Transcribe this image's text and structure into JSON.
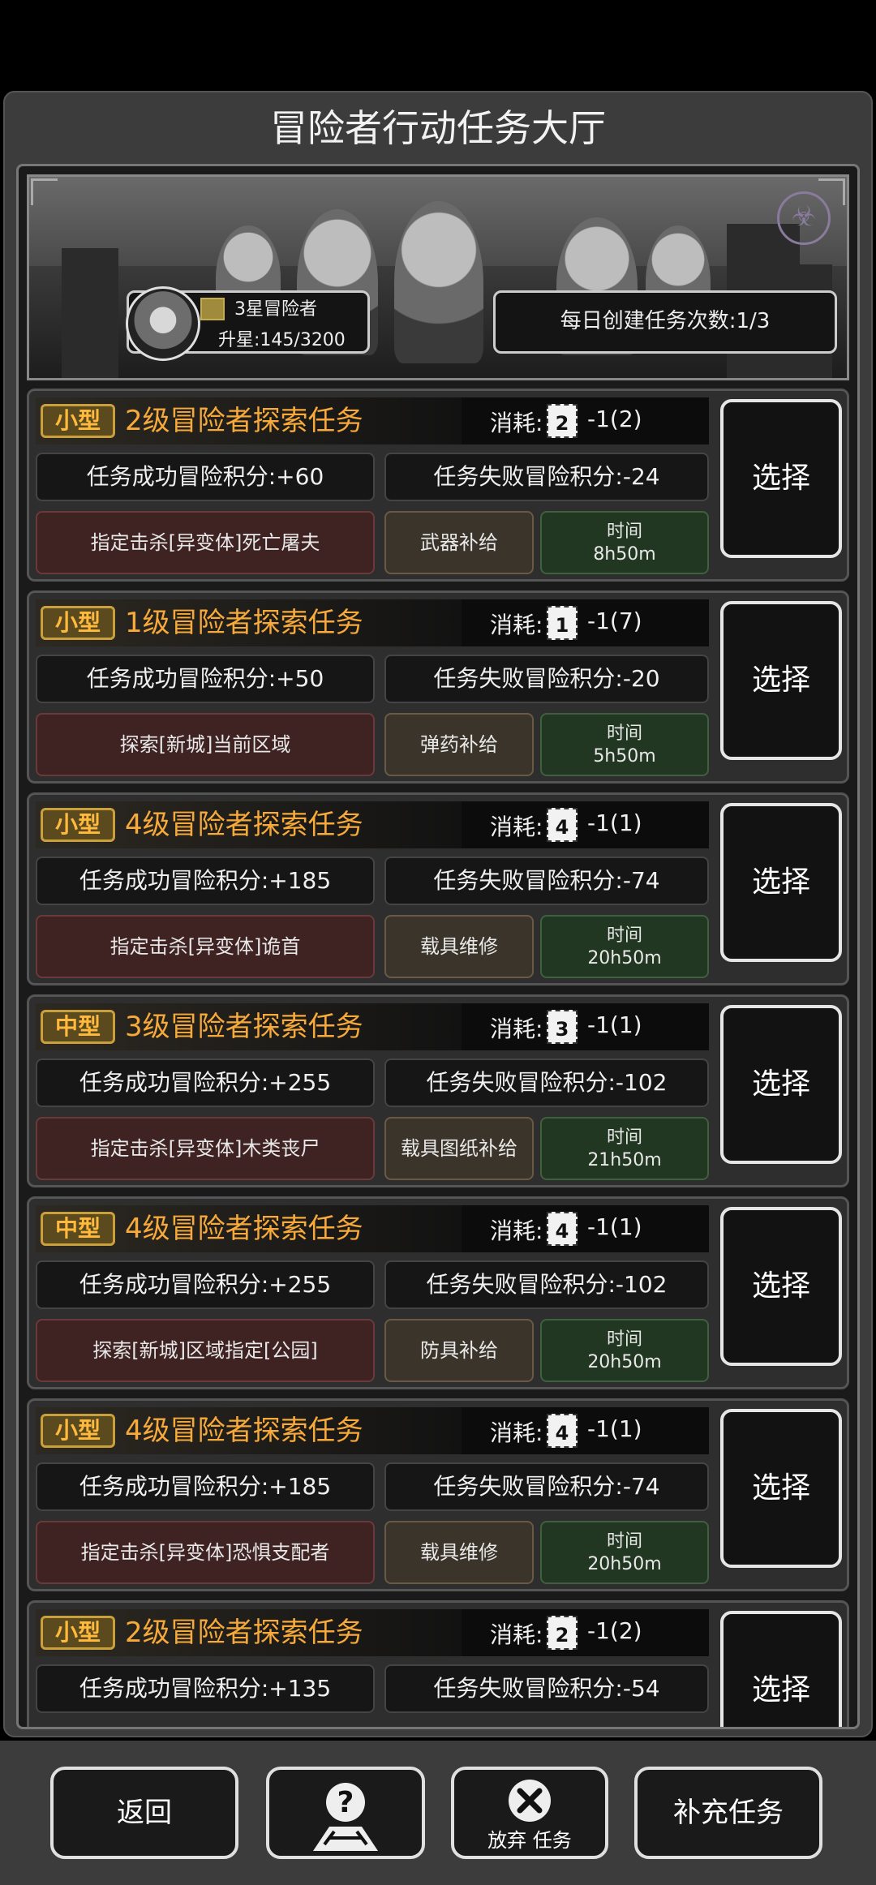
{
  "header": {
    "title": "冒险者行动任务大厅"
  },
  "rank": {
    "title": "3星冒险者",
    "progress": "升星:145/3200"
  },
  "daily": {
    "label": "每日创建任务次数:1/3"
  },
  "missions": [
    {
      "type": "小型",
      "name": "2级冒险者探索任务",
      "cost_label": "消耗:",
      "lv": "2",
      "cost_value": "-1(2)",
      "success": "任务成功冒险积分:+60",
      "fail": "任务失败冒险积分:-24",
      "objective": "指定击杀[异变体]死亡屠夫",
      "reward": "武器补给",
      "time_label": "时间",
      "time_value": "8h50m",
      "select_label": "选择"
    },
    {
      "type": "小型",
      "name": "1级冒险者探索任务",
      "cost_label": "消耗:",
      "lv": "1",
      "cost_value": "-1(7)",
      "success": "任务成功冒险积分:+50",
      "fail": "任务失败冒险积分:-20",
      "objective": "探索[新城]当前区域",
      "reward": "弹药补给",
      "time_label": "时间",
      "time_value": "5h50m",
      "select_label": "选择"
    },
    {
      "type": "小型",
      "name": "4级冒险者探索任务",
      "cost_label": "消耗:",
      "lv": "4",
      "cost_value": "-1(1)",
      "success": "任务成功冒险积分:+185",
      "fail": "任务失败冒险积分:-74",
      "objective": "指定击杀[异变体]诡首",
      "reward": "载具维修",
      "time_label": "时间",
      "time_value": "20h50m",
      "select_label": "选择"
    },
    {
      "type": "中型",
      "name": "3级冒险者探索任务",
      "cost_label": "消耗:",
      "lv": "3",
      "cost_value": "-1(1)",
      "success": "任务成功冒险积分:+255",
      "fail": "任务失败冒险积分:-102",
      "objective": "指定击杀[异变体]木类丧尸",
      "reward": "载具图纸补给",
      "time_label": "时间",
      "time_value": "21h50m",
      "select_label": "选择"
    },
    {
      "type": "中型",
      "name": "4级冒险者探索任务",
      "cost_label": "消耗:",
      "lv": "4",
      "cost_value": "-1(1)",
      "success": "任务成功冒险积分:+255",
      "fail": "任务失败冒险积分:-102",
      "objective": "探索[新城]区域指定[公园]",
      "reward": "防具补给",
      "time_label": "时间",
      "time_value": "20h50m",
      "select_label": "选择"
    },
    {
      "type": "小型",
      "name": "4级冒险者探索任务",
      "cost_label": "消耗:",
      "lv": "4",
      "cost_value": "-1(1)",
      "success": "任务成功冒险积分:+185",
      "fail": "任务失败冒险积分:-74",
      "objective": "指定击杀[异变体]恐惧支配者",
      "reward": "载具维修",
      "time_label": "时间",
      "time_value": "20h50m",
      "select_label": "选择"
    },
    {
      "type": "小型",
      "name": "2级冒险者探索任务",
      "cost_label": "消耗:",
      "lv": "2",
      "cost_value": "-1(2)",
      "success": "任务成功冒险积分:+135",
      "fail": "任务失败冒险积分:-54",
      "objective": "",
      "reward": "",
      "time_label": "",
      "time_value": "",
      "select_label": "选择"
    }
  ],
  "footer": {
    "back_label": "返回",
    "help_icon": "help-map-icon",
    "abandon_label": "放弃 任务",
    "replenish_label": "补充任务"
  },
  "colors": {
    "accent_orange": "#f7a93a",
    "objective_red": "#3f2222",
    "reward_brown": "#3b342a",
    "time_green": "#223722"
  }
}
